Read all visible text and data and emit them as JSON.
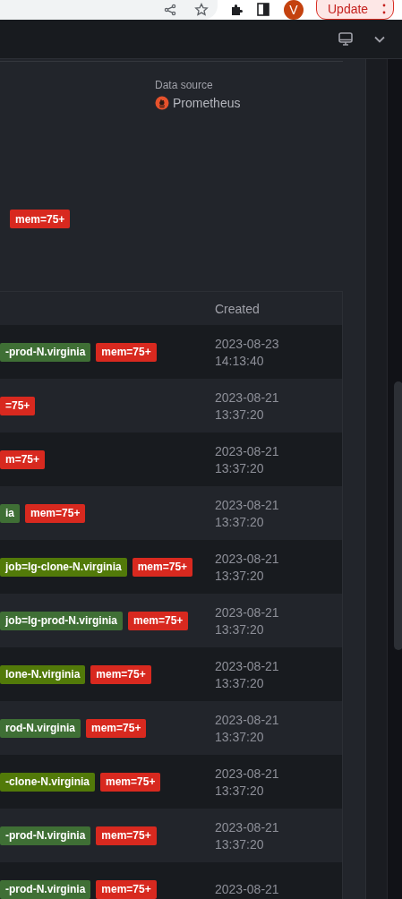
{
  "browser": {
    "avatar": "V",
    "update_button": "Update"
  },
  "panel": {
    "data_source_label": "Data source",
    "data_source": "Prometheus",
    "tags": [
      {
        "text": "mem=75+",
        "color": "#d8291f"
      }
    ]
  },
  "table": {
    "columns": [
      "Created"
    ],
    "rows": [
      {
        "tags": [
          {
            "text": "-prod-N.virginia",
            "color": "#3f6f35"
          },
          {
            "text": "mem=75+",
            "color": "#d8291f"
          }
        ],
        "date": "2023-08-23",
        "time": "14:13:40"
      },
      {
        "tags": [
          {
            "text": "=75+",
            "color": "#d8291f"
          }
        ],
        "date": "2023-08-21",
        "time": "13:37:20"
      },
      {
        "tags": [
          {
            "text": "m=75+",
            "color": "#d8291f"
          }
        ],
        "date": "2023-08-21",
        "time": "13:37:20"
      },
      {
        "tags": [
          {
            "text": "ia",
            "color": "#3f6f35"
          },
          {
            "text": "mem=75+",
            "color": "#d8291f"
          }
        ],
        "date": "2023-08-21",
        "time": "13:37:20"
      },
      {
        "tags": [
          {
            "text": "job=lg-clone-N.virginia",
            "color": "#527a09"
          },
          {
            "text": "mem=75+",
            "color": "#d8291f"
          }
        ],
        "date": "2023-08-21",
        "time": "13:37:20"
      },
      {
        "tags": [
          {
            "text": "job=lg-prod-N.virginia",
            "color": "#3f6f35"
          },
          {
            "text": "mem=75+",
            "color": "#d8291f"
          }
        ],
        "date": "2023-08-21",
        "time": "13:37:20"
      },
      {
        "tags": [
          {
            "text": "lone-N.virginia",
            "color": "#527a09"
          },
          {
            "text": "mem=75+",
            "color": "#d8291f"
          }
        ],
        "date": "2023-08-21",
        "time": "13:37:20"
      },
      {
        "tags": [
          {
            "text": "rod-N.virginia",
            "color": "#3f6f35"
          },
          {
            "text": "mem=75+",
            "color": "#d8291f"
          }
        ],
        "date": "2023-08-21",
        "time": "13:37:20"
      },
      {
        "tags": [
          {
            "text": "-clone-N.virginia",
            "color": "#527a09"
          },
          {
            "text": "mem=75+",
            "color": "#d8291f"
          }
        ],
        "date": "2023-08-21",
        "time": "13:37:20"
      },
      {
        "tags": [
          {
            "text": "-prod-N.virginia",
            "color": "#3f6f35"
          },
          {
            "text": "mem=75+",
            "color": "#d8291f"
          }
        ],
        "date": "2023-08-21",
        "time": "13:37:20"
      },
      {
        "tags": [
          {
            "text": "-prod-N.virginia",
            "color": "#3f6f35"
          },
          {
            "text": "mem=75+",
            "color": "#d8291f"
          }
        ],
        "date": "2023-08-21"
      }
    ]
  }
}
